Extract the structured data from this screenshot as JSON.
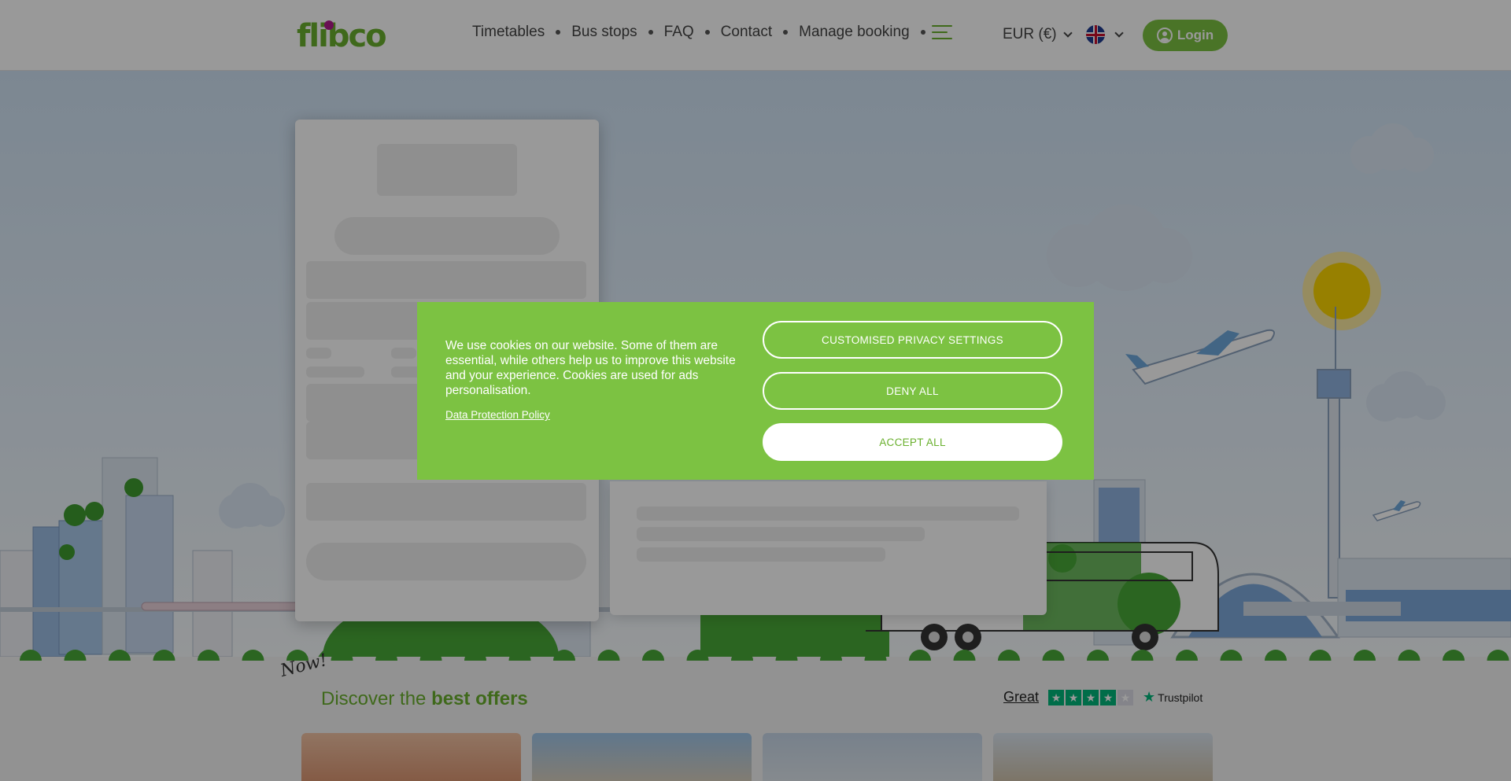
{
  "header": {
    "logo": "flibco",
    "nav": [
      "Timetables",
      "Bus stops",
      "FAQ",
      "Contact",
      "Manage booking"
    ],
    "currency": "EUR (€)",
    "login_label": "Login"
  },
  "offers": {
    "badge": "Now!",
    "title_plain": "Discover the",
    "title_bold": "best offers"
  },
  "trustpilot": {
    "rating_text": "Great",
    "stars": 4,
    "brand": "Trustpilot"
  },
  "cookie_banner": {
    "text": "We use cookies on our website. Some of them are essential, while others help us to improve this website and your experience. Cookies are used for ads personalisation.",
    "policy_link": "Data Protection Policy",
    "btn_custom": "CUSTOMISED PRIVACY SETTINGS",
    "btn_deny": "DENY ALL",
    "btn_accept": "ACCEPT ALL"
  },
  "colors": {
    "brand_green": "#7cc242",
    "logo_dot": "#b0198a"
  },
  "icons": [
    "menu-icon",
    "chevron-down-icon",
    "uk-flag-icon",
    "user-icon",
    "trustpilot-star-icon"
  ]
}
